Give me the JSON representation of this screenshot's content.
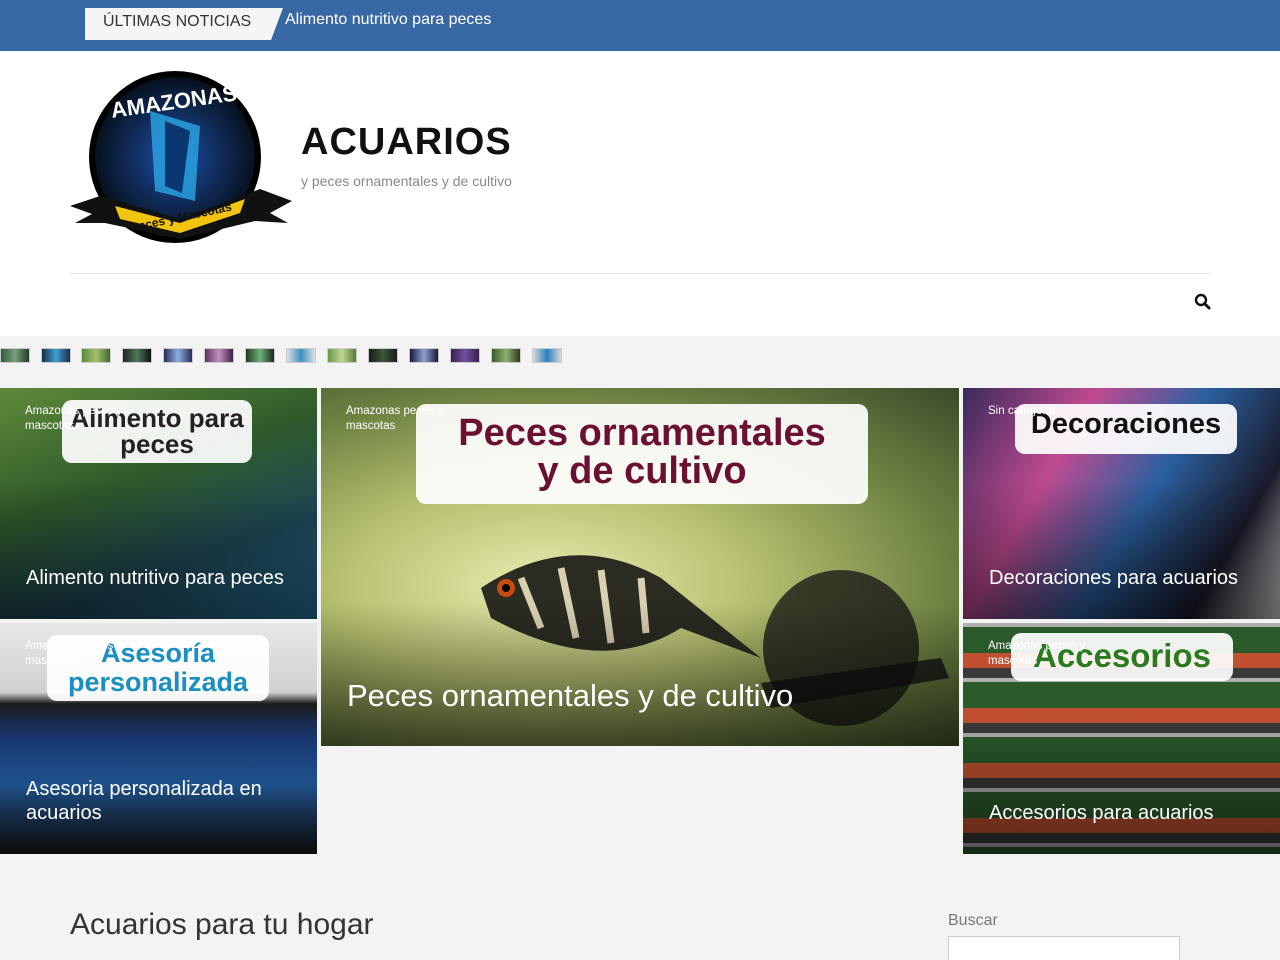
{
  "ticker": {
    "label": "ÚLTIMAS NOTICIAS",
    "headline": "Alimento nutritivo para peces"
  },
  "header": {
    "logo_top_text": "AMAZONAS",
    "logo_ribbon_text": "Peces y Mascotas",
    "site_title": "ACUARIOS",
    "site_description": "y peces ornamentales y de cultivo"
  },
  "thumbnails": [
    "thumb",
    "thumb",
    "thumb",
    "thumb",
    "thumb",
    "thumb",
    "thumb",
    "thumb",
    "thumb",
    "thumb",
    "thumb",
    "thumb",
    "thumb",
    "thumb"
  ],
  "featured": {
    "alimento": {
      "category": "Amazonas peces y mascotas",
      "banner": "Alimento para peces",
      "title": "Alimento nutritivo para peces"
    },
    "peces": {
      "category": "Amazonas peces y mascotas",
      "banner_line1": "Peces ornamentales",
      "banner_line2": "y de cultivo",
      "title": "Peces ornamentales y de cultivo"
    },
    "decoraciones": {
      "category": "Sin categoría",
      "banner": "Decoraciones",
      "title": "Decoraciones para acuarios"
    },
    "asesoria": {
      "category": "Amazonas peces y mascotas",
      "banner_line1": "Asesoría",
      "banner_line2": "personalizada",
      "title": "Asesoria personalizada en acuarios"
    },
    "accesorios": {
      "category": "Amazonas peces y mascotas",
      "banner": "Accesorios",
      "title": "Accesorios para acuarios"
    }
  },
  "main": {
    "heading": "Acuarios para tu hogar"
  },
  "sidebar": {
    "search_label": "Buscar"
  },
  "colors": {
    "ticker_bg": "#3868a3",
    "page_bg": "#f3f3f3"
  }
}
